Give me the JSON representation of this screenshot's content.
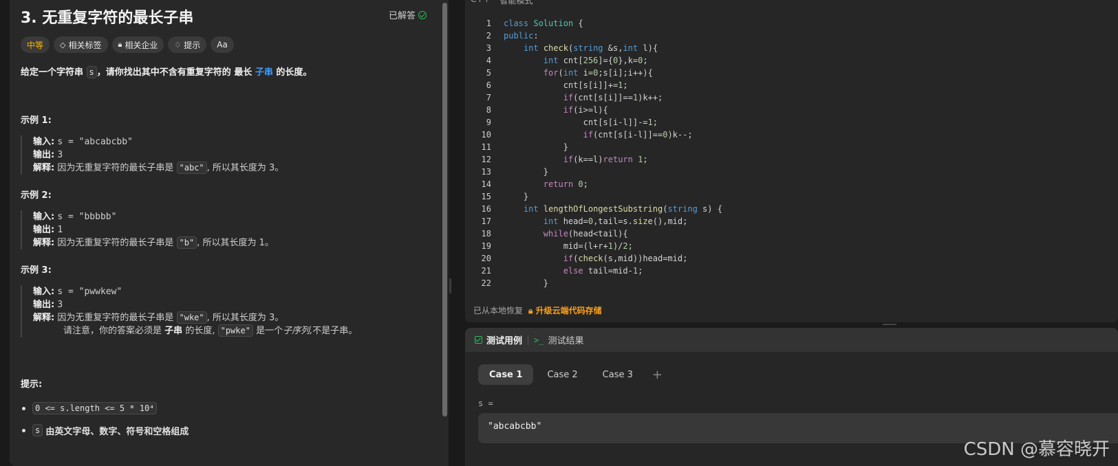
{
  "problem": {
    "title": "3. 无重复字符的最长子串",
    "status": "已解答",
    "tags": [
      "中等",
      "相关标签",
      "相关企业",
      "提示",
      "Aa"
    ],
    "desc_prefix": "给定一个字符串",
    "desc_var": "s",
    "desc_middle": "，请你找出其中不含有重复字符的",
    "desc_bold": "最长",
    "desc_link": "子串",
    "desc_suffix": "的长度。",
    "examples": [
      {
        "title": "示例 1:",
        "input_label": "输入:",
        "input": "s = \"abcabcbb\"",
        "output_label": "输出:",
        "output": "3",
        "explain_label": "解释:",
        "explain_pre": "因为无重复字符的最长子串是",
        "explain_code": "\"abc\"",
        "explain_post": ", 所以其长度为 3。"
      },
      {
        "title": "示例 2:",
        "input_label": "输入:",
        "input": "s = \"bbbbb\"",
        "output_label": "输出:",
        "output": "1",
        "explain_label": "解释:",
        "explain_pre": "因为无重复字符的最长子串是",
        "explain_code": "\"b\"",
        "explain_post": ", 所以其长度为 1。"
      },
      {
        "title": "示例 3:",
        "input_label": "输入:",
        "input": "s = \"pwwkew\"",
        "output_label": "输出:",
        "output": "3",
        "explain_label": "解释:",
        "explain_pre": "因为无重复字符的最长子串是",
        "explain_code": "\"wke\"",
        "explain_post": ", 所以其长度为 3。",
        "note_pre": "请注意，你的答案必须是",
        "note_bold": "子串",
        "note_mid": "的长度,",
        "note_code": "\"pwke\"",
        "note_mid2": "是一个",
        "note_ital": "子序列,",
        "note_post": "不是子串。"
      }
    ],
    "hint_title": "提示:",
    "hints": [
      {
        "code": "0 <= s.length <= 5 * 10⁴",
        "text": ""
      },
      {
        "code": "s",
        "text": "由英文字母、数字、符号和空格组成"
      }
    ]
  },
  "editor": {
    "topbar_lang": "C++",
    "topbar_mode": "智能模式",
    "restored": "已从本地恢复",
    "upgrade": "升级云端代码存储"
  },
  "tests": {
    "tab_cases": "测试用例",
    "tab_results": "测试结果",
    "cases": [
      "Case 1",
      "Case 2",
      "Case 3"
    ],
    "var_label": "s =",
    "var_value": "\"abcabcbb\""
  },
  "watermark": "CSDN @慕容晓开"
}
